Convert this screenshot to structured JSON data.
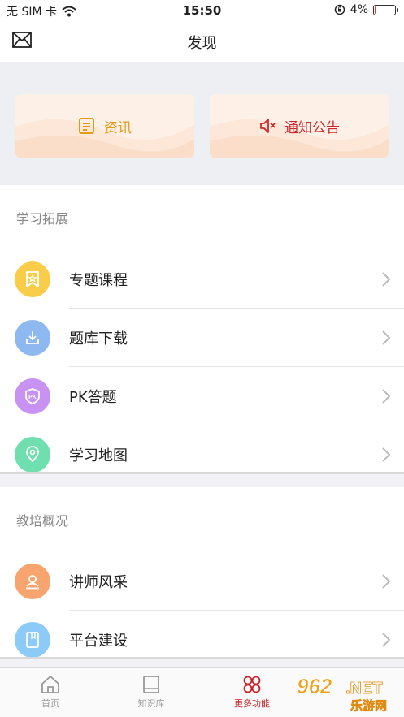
{
  "status_bar": {
    "carrier": "无 SIM 卡",
    "time": "15:50",
    "battery": "4%",
    "battery_level": 0.04
  },
  "nav": {
    "title": "发现"
  },
  "cards": [
    {
      "label": "资讯",
      "icon": "news-icon",
      "color": "#e49a14"
    },
    {
      "label": "通知公告",
      "icon": "speaker-icon",
      "color": "#d0262b"
    }
  ],
  "learning": {
    "title": "学习拓展",
    "items": [
      {
        "label": "专题课程",
        "icon": "bookmark-star-icon",
        "color": "#f9cd4a"
      },
      {
        "label": "题库下载",
        "icon": "download-icon",
        "color": "#8db8f0"
      },
      {
        "label": "PK答题",
        "icon": "pk-shield-icon",
        "color": "#c792f2"
      },
      {
        "label": "学习地图",
        "icon": "map-pin-icon",
        "color": "#6fdfb0"
      }
    ]
  },
  "training": {
    "title": "教培概况",
    "items": [
      {
        "label": "讲师风采",
        "icon": "lecturer-icon",
        "color": "#f7a46e"
      },
      {
        "label": "平台建设",
        "icon": "book-icon",
        "color": "#8ccbf7"
      }
    ]
  },
  "tabs": [
    {
      "label": "首页",
      "icon": "home-icon"
    },
    {
      "label": "知识库",
      "icon": "book-icon"
    },
    {
      "label": "更多功能",
      "icon": "more-icon",
      "active": true
    }
  ],
  "watermark": {
    "text": "962.NET",
    "subtext": "乐游网"
  }
}
